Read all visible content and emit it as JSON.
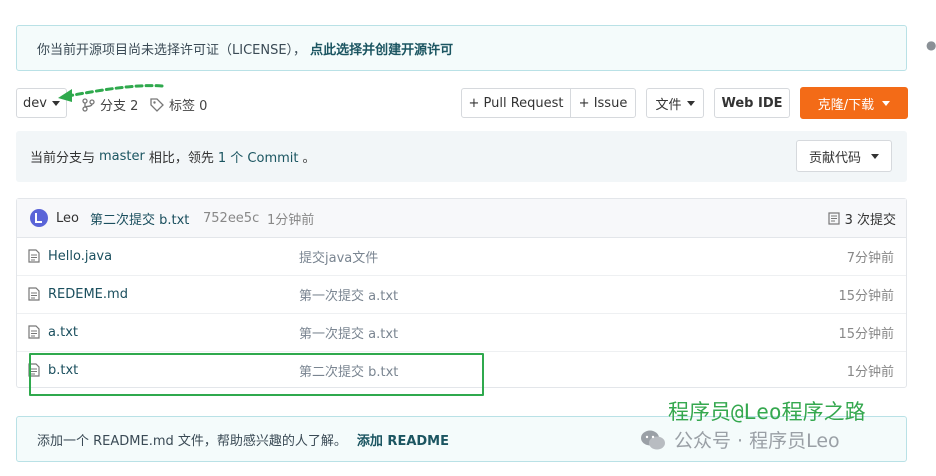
{
  "notice": {
    "text": "你当前开源项目尚未选择许可证（LICENSE），",
    "link": "点此选择并创建开源许可"
  },
  "toolbar": {
    "branch": "dev",
    "branches_label": "分支 2",
    "tags_label": "标签 0",
    "pull_request": "+ Pull Request",
    "issue": "+ Issue",
    "file_menu": "文件",
    "web_ide": "Web IDE",
    "clone": "克隆/下载"
  },
  "compare": {
    "prefix": "当前分支与",
    "base": "master",
    "middle": "相比，领先",
    "ahead": "1 个 Commit",
    "suffix": "。",
    "contribute": "贡献代码"
  },
  "commit": {
    "author": "Leo",
    "message": "第二次提交 b.txt",
    "hash": "752ee5c",
    "time": "1分钟前",
    "count": "3 次提交"
  },
  "files": [
    {
      "name": "Hello.java",
      "message": "提交java文件",
      "time": "7分钟前"
    },
    {
      "name": "REDEME.md",
      "message": "第一次提交 a.txt",
      "time": "15分钟前"
    },
    {
      "name": "a.txt",
      "message": "第一次提交 a.txt",
      "time": "15分钟前"
    },
    {
      "name": "b.txt",
      "message": "第二次提交 b.txt",
      "time": "1分钟前"
    }
  ],
  "readme": {
    "text": "添加一个 README.md 文件，帮助感兴趣的人了解。",
    "link": "添加 README"
  },
  "watermark": {
    "line1": "程序员@Leo程序之路",
    "line2": "公众号 · 程序员Leo"
  },
  "colors": {
    "accent": "#f36b17",
    "link": "#1b5561",
    "arrow": "#2fa94d"
  }
}
